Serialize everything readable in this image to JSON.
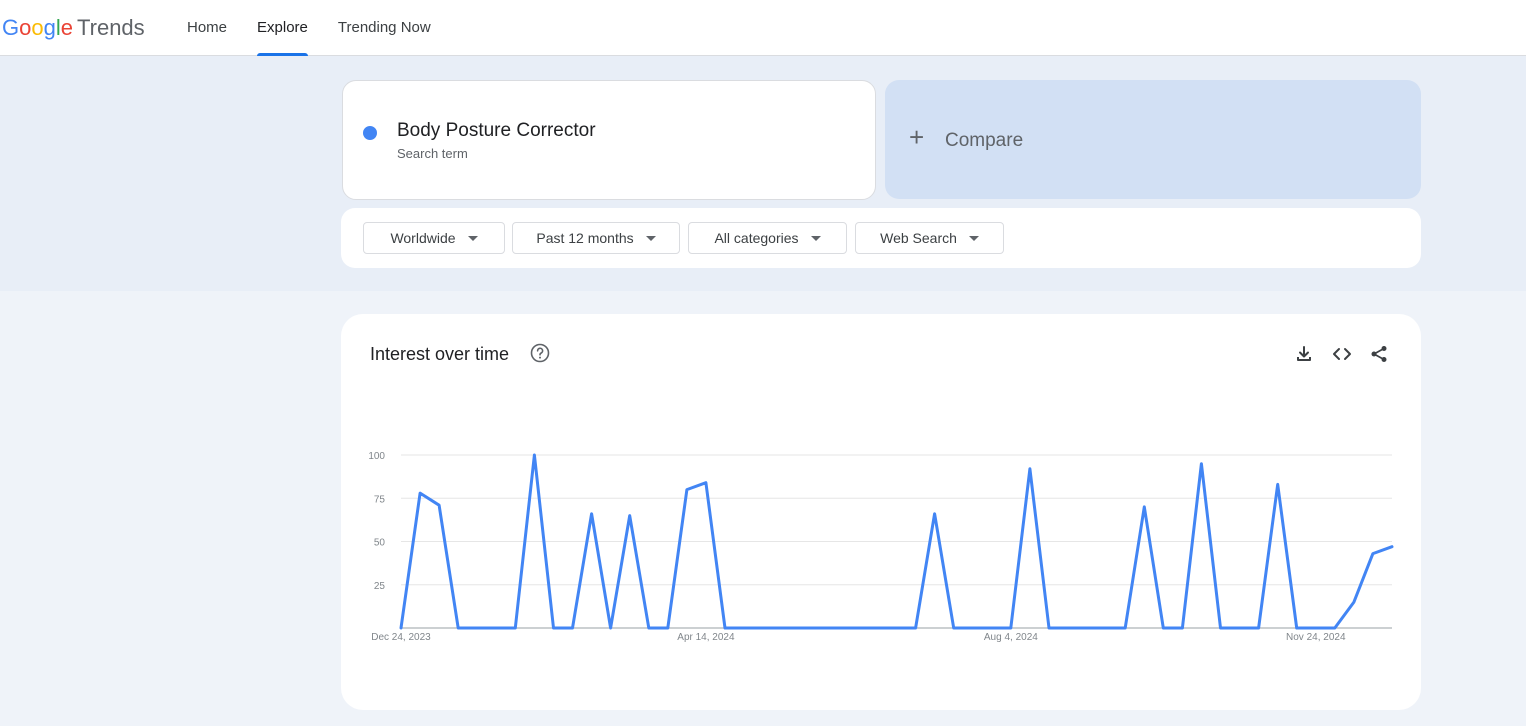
{
  "header": {
    "logo_google": [
      "G",
      "o",
      "o",
      "g",
      "l",
      "e"
    ],
    "logo_product": "Trends",
    "tabs": [
      {
        "label": "Home",
        "active": false
      },
      {
        "label": "Explore",
        "active": true
      },
      {
        "label": "Trending Now",
        "active": false
      }
    ]
  },
  "search": {
    "term": "Body Posture Corrector",
    "term_type": "Search term",
    "term_color": "#4285f4",
    "compare_label": "Compare"
  },
  "filters": {
    "region": "Worldwide",
    "time_range": "Past 12 months",
    "category": "All categories",
    "property": "Web Search"
  },
  "panel": {
    "title": "Interest over time",
    "icons": [
      "help-icon",
      "download-icon",
      "embed-icon",
      "share-icon"
    ]
  },
  "chart_data": {
    "type": "line",
    "y_ticks": [
      25,
      50,
      75,
      100
    ],
    "ylim": [
      0,
      100
    ],
    "x_labels": [
      "Dec 24, 2023",
      "Apr 14, 2024",
      "Aug 4, 2024",
      "Nov 24, 2024"
    ],
    "x_label_indices": [
      0,
      16,
      32,
      48
    ],
    "grid": true,
    "color": "#4285f4",
    "series": [
      {
        "values": [
          0,
          78,
          71,
          0,
          0,
          0,
          0,
          100,
          0,
          0,
          66,
          0,
          65,
          0,
          0,
          80,
          84,
          0,
          0,
          0,
          0,
          0,
          0,
          0,
          0,
          0,
          0,
          0,
          66,
          0,
          0,
          0,
          0,
          92,
          0,
          0,
          0,
          0,
          0,
          70,
          0,
          0,
          95,
          0,
          0,
          0,
          83,
          0,
          0,
          0,
          15,
          43,
          47
        ]
      }
    ]
  }
}
